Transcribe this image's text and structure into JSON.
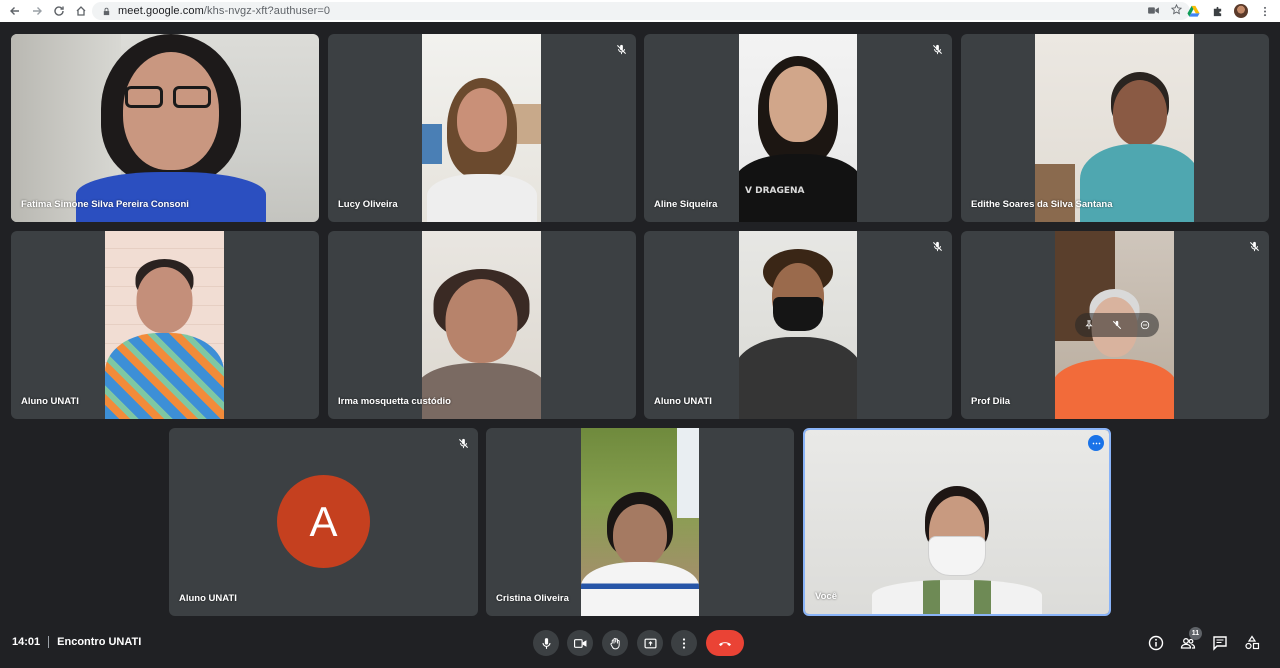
{
  "browser": {
    "url_host": "meet.google.com",
    "url_path": "/khs-nvgz-xft?authuser=0"
  },
  "participants": [
    {
      "name": "Fatima Simone Silva Pereira Consoni",
      "muted": false
    },
    {
      "name": "Lucy Oliveira",
      "muted": true
    },
    {
      "name": "Aline Siqueira",
      "muted": true
    },
    {
      "name": "Edithe Soares da Silva Santana",
      "muted": false
    },
    {
      "name": "Aluno UNATI",
      "muted": false
    },
    {
      "name": "Irma mosquetta custódio",
      "muted": false
    },
    {
      "name": "Aluno UNATI",
      "muted": true
    },
    {
      "name": "Prof Dila",
      "muted": true
    },
    {
      "name": "Aluno UNATI",
      "muted": true,
      "avatar_letter": "A",
      "avatar_color": "#c5401f"
    },
    {
      "name": "Cristina Oliveira",
      "muted": false
    },
    {
      "name": "Você",
      "muted": false
    }
  ],
  "meeting": {
    "time": "14:01",
    "title": "Encontro UNATI",
    "participant_count": "11"
  },
  "colors": {
    "background": "#202124",
    "tile": "#3c4043",
    "end_call": "#ea4335",
    "self_border": "#8ab4f8",
    "more_button": "#1a73e8"
  }
}
